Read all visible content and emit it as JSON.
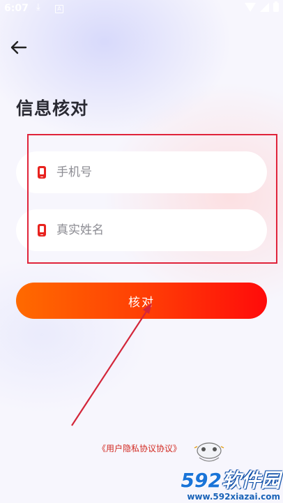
{
  "status_bar": {
    "time": "6:07",
    "download_glyph": "⤓",
    "notification_glyph": "A",
    "icons": [
      "download-icon",
      "notification-icon",
      "wifi-icon",
      "signal-icon",
      "battery-icon"
    ]
  },
  "header": {
    "back_icon": "arrow-left-icon",
    "title": "信息核对"
  },
  "form": {
    "phone": {
      "placeholder": "手机号",
      "value": "",
      "icon": "phone-icon"
    },
    "name": {
      "placeholder": "真实姓名",
      "value": "",
      "icon": "phone-icon"
    }
  },
  "actions": {
    "verify_label": "核对"
  },
  "footer": {
    "agreement_text": "《用户隐私协议协议》",
    "mascot_icon": "gamepad-mascot-icon"
  },
  "watermark": {
    "logo_number": "592",
    "logo_text": "软件园",
    "url": "www.592xiazai.com"
  },
  "colors": {
    "accent_start": "#ff6a00",
    "accent_end": "#ff0b0b",
    "icon_red": "#e8231f",
    "annotation_red": "#e0233a",
    "title": "#2a2a33"
  }
}
